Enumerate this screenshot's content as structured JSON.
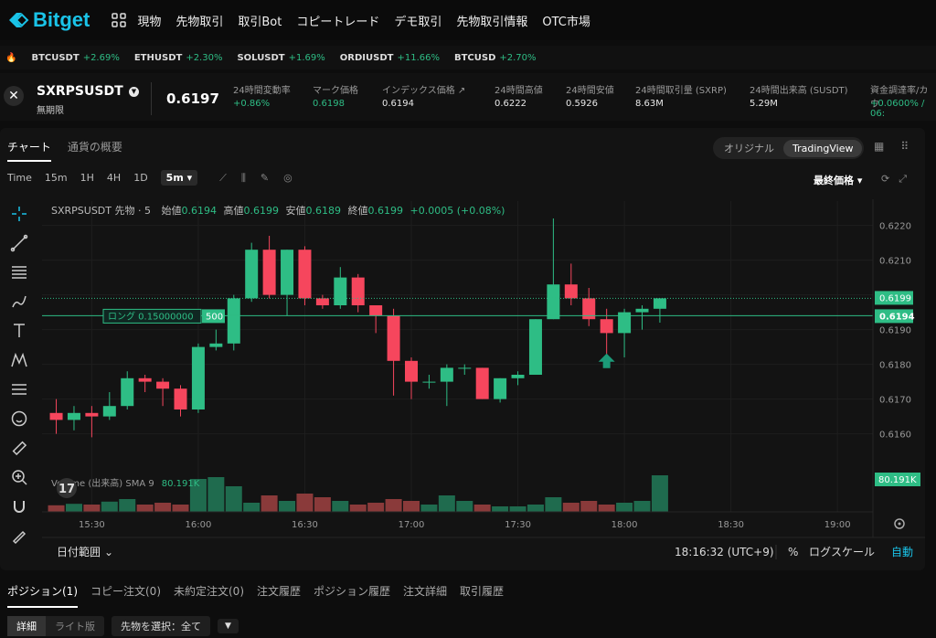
{
  "brand": {
    "name": "Bitget"
  },
  "nav": [
    "現物",
    "先物取引",
    "取引Bot",
    "コピートレード",
    "デモ取引",
    "先物取引情報",
    "OTC市場"
  ],
  "ticker": [
    {
      "sym": "BTCUSDT",
      "chg": "+2.69%"
    },
    {
      "sym": "ETHUSDT",
      "chg": "+2.30%"
    },
    {
      "sym": "SOLUSDT",
      "chg": "+1.69%"
    },
    {
      "sym": "ORDIUSDT",
      "chg": "+11.66%"
    },
    {
      "sym": "BTCUSD",
      "chg": "+2.70%"
    }
  ],
  "symbol": {
    "name": "SXRPSUSDT",
    "sub": "無期限",
    "last": "0.6197"
  },
  "stats": [
    {
      "label": "24時間変動率",
      "value": "+0.86%",
      "green": true
    },
    {
      "label": "マーク価格",
      "value": "0.6198",
      "green": true
    },
    {
      "label": "インデックス価格",
      "value": "0.6194",
      "green": false
    },
    {
      "label": "24時間高値",
      "value": "0.6222",
      "green": false
    },
    {
      "label": "24時間安値",
      "value": "0.5926",
      "green": false
    },
    {
      "label": "24時間取引量 (SXRP)",
      "value": "8.63M",
      "green": false
    },
    {
      "label": "24時間出来高 (SUSDT)",
      "value": "5.29M",
      "green": false
    },
    {
      "label": "資金調達率/カウ",
      "value": "+0.0600% / 06:",
      "green": true
    }
  ],
  "tabs": {
    "chart": "チャート",
    "overview": "通貨の概要"
  },
  "view_toggle": {
    "original": "オリジナル",
    "tradingview": "TradingView"
  },
  "timeframes": [
    "Time",
    "15m",
    "1H",
    "4H",
    "1D"
  ],
  "selected_tf": "5m",
  "price_select": "最終価格",
  "legend": {
    "title": "SXRPSUSDT 先物 · 5",
    "open_l": "始値",
    "open": "0.6194",
    "high_l": "高値",
    "high": "0.6199",
    "low_l": "安値",
    "low": "0.6189",
    "close_l": "終値",
    "close": "0.6199",
    "change": "+0.0005 (+0.08%)"
  },
  "position_label": "ロング 0.15000000",
  "position_qty": "500",
  "volume_label": "Volume (出来高) SMA 9",
  "volume_value": "80.191K",
  "price_ticks": [
    "0.6220",
    "0.6210",
    "0.6190",
    "0.6180",
    "0.6170",
    "0.6160"
  ],
  "badges": {
    "last": "0.6199",
    "line": "0.6194",
    "vol": "80.191K"
  },
  "time_ticks": [
    "15:30",
    "16:00",
    "16:30",
    "17:00",
    "17:30",
    "18:00",
    "18:30",
    "19:00"
  ],
  "footer": {
    "range": "日付範囲",
    "clock": "18:16:32 (UTC+9)",
    "pct": "%",
    "log": "ログスケール",
    "auto": "自動"
  },
  "bottom_tabs": [
    "ポジション(1)",
    "コピー注文(0)",
    "未約定注文(0)",
    "注文履歴",
    "ポジション履歴",
    "注文詳細",
    "取引履歴"
  ],
  "bottom_sub": {
    "detail": "詳細",
    "lite": "ライト版",
    "select": "先物を選択：全て"
  },
  "colors": {
    "up": "#2ebd85",
    "down": "#f6465d",
    "accent": "#1ac3e8"
  },
  "chart_data": {
    "type": "candlestick",
    "ylim": [
      0.6152,
      0.6227
    ],
    "candles": [
      {
        "t": "15:20",
        "o": 0.6166,
        "h": 0.617,
        "l": 0.616,
        "c": 0.6164
      },
      {
        "t": "15:25",
        "o": 0.6164,
        "h": 0.6168,
        "l": 0.6161,
        "c": 0.6166
      },
      {
        "t": "15:30",
        "o": 0.6166,
        "h": 0.6168,
        "l": 0.6159,
        "c": 0.6165
      },
      {
        "t": "15:35",
        "o": 0.6165,
        "h": 0.6172,
        "l": 0.6164,
        "c": 0.6168
      },
      {
        "t": "15:40",
        "o": 0.6168,
        "h": 0.6178,
        "l": 0.6167,
        "c": 0.6176
      },
      {
        "t": "15:45",
        "o": 0.6176,
        "h": 0.6177,
        "l": 0.6172,
        "c": 0.6175
      },
      {
        "t": "15:50",
        "o": 0.6175,
        "h": 0.6176,
        "l": 0.6168,
        "c": 0.6173
      },
      {
        "t": "15:55",
        "o": 0.6173,
        "h": 0.6174,
        "l": 0.6165,
        "c": 0.6167
      },
      {
        "t": "16:00",
        "o": 0.6167,
        "h": 0.6186,
        "l": 0.6166,
        "c": 0.6185
      },
      {
        "t": "16:05",
        "o": 0.6185,
        "h": 0.619,
        "l": 0.6184,
        "c": 0.6186
      },
      {
        "t": "16:10",
        "o": 0.6186,
        "h": 0.62,
        "l": 0.6184,
        "c": 0.6199
      },
      {
        "t": "16:15",
        "o": 0.6199,
        "h": 0.6215,
        "l": 0.6198,
        "c": 0.6213
      },
      {
        "t": "16:20",
        "o": 0.6213,
        "h": 0.6217,
        "l": 0.6199,
        "c": 0.62
      },
      {
        "t": "16:25",
        "o": 0.62,
        "h": 0.6213,
        "l": 0.6194,
        "c": 0.6213
      },
      {
        "t": "16:30",
        "o": 0.6213,
        "h": 0.6214,
        "l": 0.6197,
        "c": 0.6199
      },
      {
        "t": "16:35",
        "o": 0.6199,
        "h": 0.62,
        "l": 0.6196,
        "c": 0.6197
      },
      {
        "t": "16:40",
        "o": 0.6197,
        "h": 0.6208,
        "l": 0.6196,
        "c": 0.6205
      },
      {
        "t": "16:45",
        "o": 0.6205,
        "h": 0.6206,
        "l": 0.6195,
        "c": 0.6197
      },
      {
        "t": "16:50",
        "o": 0.6197,
        "h": 0.6197,
        "l": 0.6189,
        "c": 0.6194
      },
      {
        "t": "16:55",
        "o": 0.6194,
        "h": 0.6196,
        "l": 0.6171,
        "c": 0.6181
      },
      {
        "t": "17:00",
        "o": 0.6181,
        "h": 0.6182,
        "l": 0.617,
        "c": 0.6175
      },
      {
        "t": "17:05",
        "o": 0.6175,
        "h": 0.6177,
        "l": 0.6173,
        "c": 0.6175
      },
      {
        "t": "17:10",
        "o": 0.6175,
        "h": 0.618,
        "l": 0.6168,
        "c": 0.6179
      },
      {
        "t": "17:15",
        "o": 0.6179,
        "h": 0.618,
        "l": 0.6177,
        "c": 0.6179
      },
      {
        "t": "17:20",
        "o": 0.6179,
        "h": 0.6179,
        "l": 0.617,
        "c": 0.617
      },
      {
        "t": "17:25",
        "o": 0.617,
        "h": 0.6176,
        "l": 0.6169,
        "c": 0.6176
      },
      {
        "t": "17:30",
        "o": 0.6176,
        "h": 0.6178,
        "l": 0.6174,
        "c": 0.6177
      },
      {
        "t": "17:35",
        "o": 0.6177,
        "h": 0.6193,
        "l": 0.6177,
        "c": 0.6193
      },
      {
        "t": "17:40",
        "o": 0.6193,
        "h": 0.6222,
        "l": 0.6193,
        "c": 0.6203
      },
      {
        "t": "17:45",
        "o": 0.6203,
        "h": 0.6209,
        "l": 0.6197,
        "c": 0.6199
      },
      {
        "t": "17:50",
        "o": 0.6199,
        "h": 0.6202,
        "l": 0.6191,
        "c": 0.6193
      },
      {
        "t": "17:55",
        "o": 0.6193,
        "h": 0.6196,
        "l": 0.6179,
        "c": 0.6189
      },
      {
        "t": "18:00",
        "o": 0.6189,
        "h": 0.6196,
        "l": 0.6182,
        "c": 0.6195
      },
      {
        "t": "18:05",
        "o": 0.6195,
        "h": 0.6197,
        "l": 0.619,
        "c": 0.6196
      },
      {
        "t": "18:10",
        "o": 0.6196,
        "h": 0.6199,
        "l": 0.6192,
        "c": 0.6199
      }
    ],
    "volume": [
      0.18,
      0.22,
      0.2,
      0.28,
      0.35,
      0.2,
      0.25,
      0.2,
      0.9,
      0.95,
      0.7,
      0.25,
      0.45,
      0.3,
      0.5,
      0.4,
      0.3,
      0.2,
      0.25,
      0.35,
      0.3,
      0.2,
      0.45,
      0.3,
      0.2,
      0.15,
      0.15,
      0.2,
      0.4,
      0.25,
      0.3,
      0.2,
      0.25,
      0.3,
      1.0
    ]
  }
}
